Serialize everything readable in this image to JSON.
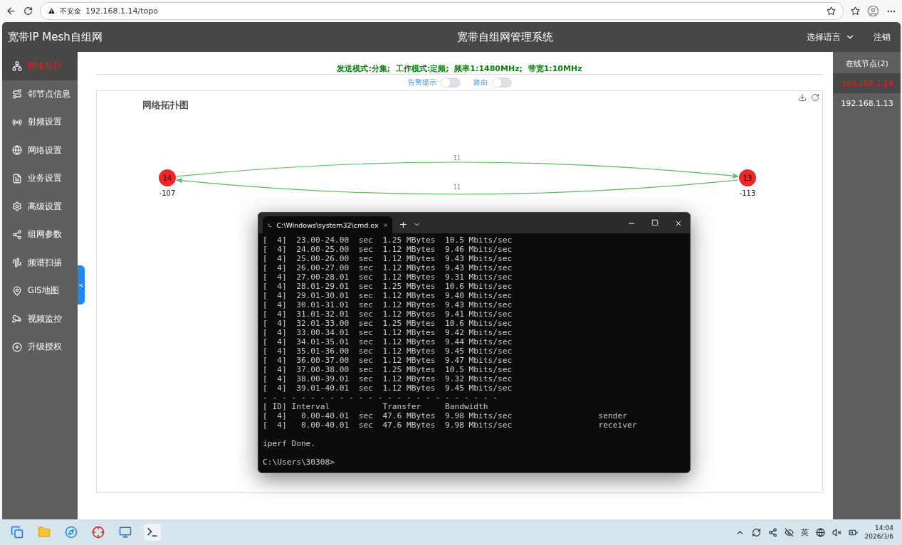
{
  "browser": {
    "security_label": "不安全",
    "url": "192.168.1.14/topo"
  },
  "header": {
    "brand": "宽带IP Mesh自组网",
    "title": "宽带自组网管理系统",
    "language": "选择语言",
    "logout": "注销"
  },
  "sidebar": {
    "items": [
      {
        "label": "网络拓扑",
        "selected": true
      },
      {
        "label": "邻节点信息",
        "selected": false
      },
      {
        "label": "射频设置",
        "selected": false
      },
      {
        "label": "网络设置",
        "selected": false
      },
      {
        "label": "业务设置",
        "selected": false
      },
      {
        "label": "高级设置",
        "selected": false
      },
      {
        "label": "组网参数",
        "selected": false
      },
      {
        "label": "频谱扫描",
        "selected": false
      },
      {
        "label": "GIS地图",
        "selected": false
      },
      {
        "label": "视频监控",
        "selected": false
      },
      {
        "label": "升级授权",
        "selected": false
      }
    ],
    "collapse": "<"
  },
  "status_line": "发送模式:分集;  工作模式:定频;  频率1:1480MHz;  带宽1:10MHz",
  "toggles": [
    {
      "label": "告警提示",
      "on": false
    },
    {
      "label": "路由",
      "on": false
    }
  ],
  "topology": {
    "title": "网络拓扑图",
    "nodes": [
      {
        "label": "14",
        "signal": "-107"
      },
      {
        "label": "13",
        "signal": "-113"
      }
    ],
    "edges": [
      {
        "label": "11"
      },
      {
        "label": "11"
      }
    ]
  },
  "online_nodes": {
    "title": "在线节点(2)",
    "items": [
      {
        "ip": "192.168.1.14",
        "selected": true
      },
      {
        "ip": "192.168.1.13",
        "selected": false
      }
    ]
  },
  "terminal": {
    "tab_title": "C:\\Windows\\system32\\cmd.ex",
    "new_tab": "+",
    "lines": [
      "[  4]  23.00-24.00  sec  1.25 MBytes  10.5 Mbits/sec",
      "[  4]  24.00-25.00  sec  1.12 MBytes  9.46 Mbits/sec",
      "[  4]  25.00-26.00  sec  1.12 MBytes  9.43 Mbits/sec",
      "[  4]  26.00-27.00  sec  1.12 MBytes  9.43 Mbits/sec",
      "[  4]  27.00-28.01  sec  1.12 MBytes  9.31 Mbits/sec",
      "[  4]  28.01-29.01  sec  1.25 MBytes  10.6 Mbits/sec",
      "[  4]  29.01-30.01  sec  1.12 MBytes  9.40 Mbits/sec",
      "[  4]  30.01-31.01  sec  1.12 MBytes  9.43 Mbits/sec",
      "[  4]  31.01-32.01  sec  1.12 MBytes  9.41 Mbits/sec",
      "[  4]  32.01-33.00  sec  1.25 MBytes  10.6 Mbits/sec",
      "[  4]  33.00-34.01  sec  1.12 MBytes  9.42 Mbits/sec",
      "[  4]  34.01-35.01  sec  1.12 MBytes  9.44 Mbits/sec",
      "[  4]  35.01-36.00  sec  1.12 MBytes  9.45 Mbits/sec",
      "[  4]  36.00-37.00  sec  1.12 MBytes  9.47 Mbits/sec",
      "[  4]  37.00-38.00  sec  1.25 MBytes  10.5 Mbits/sec",
      "[  4]  38.00-39.01  sec  1.12 MBytes  9.32 Mbits/sec",
      "[  4]  39.01-40.01  sec  1.12 MBytes  9.45 Mbits/sec",
      "- - - - - - - - - - - - - - - - - - - - - - - - -",
      "[ ID] Interval           Transfer     Bandwidth",
      "[  4]   0.00-40.01  sec  47.6 MBytes  9.98 Mbits/sec                  sender",
      "[  4]   0.00-40.01  sec  47.6 MBytes  9.98 Mbits/sec                  receiver"
    ],
    "done": "iperf Done.",
    "prompt": "C:\\Users\\30308>"
  },
  "taskbar": {
    "ime": "英",
    "time": "14:04",
    "date": "2026/3/6"
  }
}
